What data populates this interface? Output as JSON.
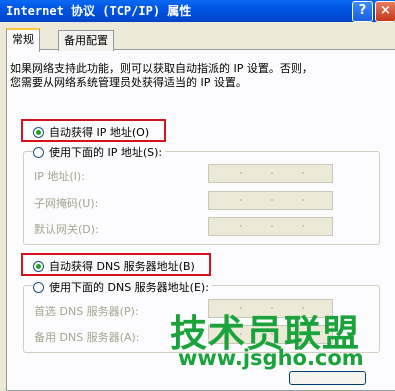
{
  "window": {
    "title": "Internet 协议 (TCP/IP) 属性",
    "help_label": "?",
    "close_label": "×"
  },
  "tabs": [
    {
      "label": "常规",
      "active": true
    },
    {
      "label": "备用配置",
      "active": false
    }
  ],
  "intro": {
    "line1": "如果网络支持此功能，则可以获取自动指派的 IP 设置。否则，",
    "line2": "您需要从网络系统管理员处获得适当的 IP 设置。"
  },
  "ip_section": {
    "auto_label": "自动获得 IP 地址(O)",
    "manual_label": "使用下面的 IP 地址(S):",
    "fields": [
      {
        "label": "IP 地址(I):"
      },
      {
        "label": "子网掩码(U):"
      },
      {
        "label": "默认网关(D):"
      }
    ]
  },
  "dns_section": {
    "auto_label": "自动获得 DNS 服务器地址(B)",
    "manual_label": "使用下面的 DNS 服务器地址(E):",
    "fields": [
      {
        "label": "首选 DNS 服务器(P):"
      },
      {
        "label": "备用 DNS 服务器(A):"
      }
    ]
  },
  "watermark": {
    "text": "技术员联盟",
    "url": "www.jsgho.com"
  },
  "colors": {
    "highlight": "#d6121e",
    "watermark": "#1aa33a",
    "title_bar": "#0054e3"
  }
}
